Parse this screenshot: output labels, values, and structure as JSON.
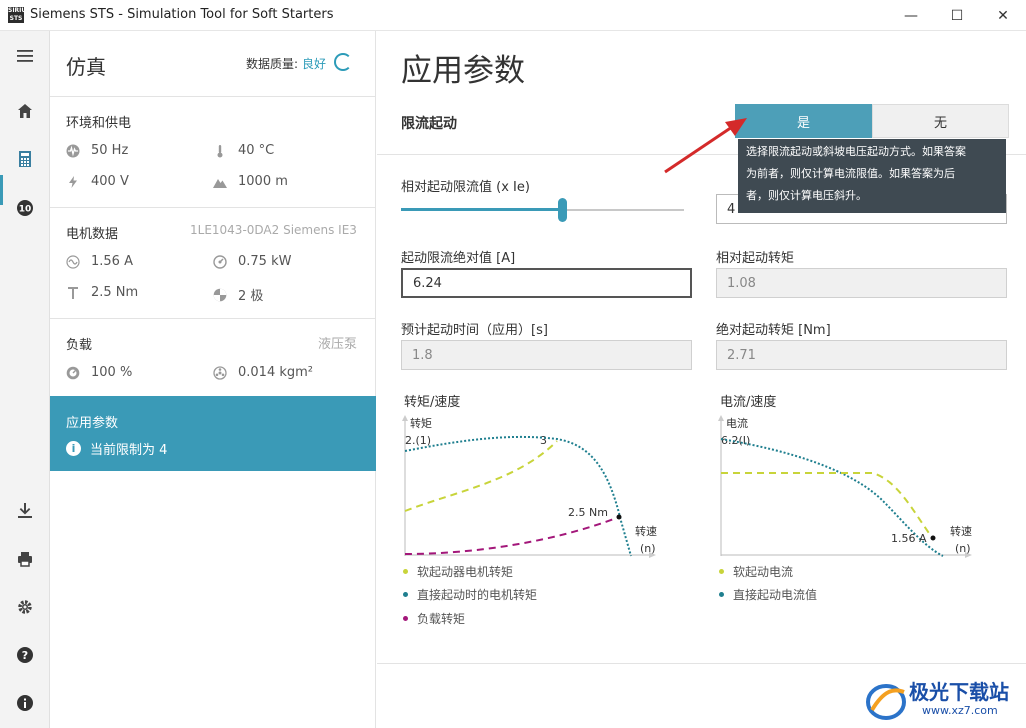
{
  "window": {
    "logo_text": "SIRIUS STS",
    "title": "Siemens STS - Simulation Tool for Soft Starters",
    "minimize": "—",
    "maximize": "☐",
    "close": "✕"
  },
  "rail": {
    "icons": [
      "menu-icon",
      "home-icon",
      "calculator-icon",
      "ten-icon",
      "download-icon",
      "print-icon",
      "settings-icon",
      "help-icon",
      "info-icon"
    ],
    "ten_label": "10"
  },
  "panel": {
    "title": "仿真",
    "quality_label": "数据质量:",
    "quality_value": "良好",
    "env": {
      "title": "环境和供电",
      "frequency": "50 Hz",
      "temperature": "40 °C",
      "voltage": "400 V",
      "altitude": "1000 m"
    },
    "motor": {
      "title": "电机数据",
      "model": "1LE1043-0DA2 Siemens IE3",
      "current": "1.56 A",
      "power": "0.75 kW",
      "torque": "2.5 Nm",
      "poles": "2 极"
    },
    "load": {
      "title": "负载",
      "type": "液压泵",
      "load_percent": "100 %",
      "inertia": "0.014 kgm²"
    },
    "active": {
      "title": "应用参数",
      "info_icon": "i",
      "info_text": "当前限制为 4"
    }
  },
  "main": {
    "title": "应用参数",
    "limit_label": "限流起动",
    "toggle_yes": "是",
    "toggle_no": "无",
    "tooltip_lines": [
      "选择限流起动或斜坡电压起动方式。如果答案",
      "为前者，则仅计算电流限值。如果答案为后",
      "者，则仅计算电压斜升。"
    ],
    "relative_limit_label": "相对起动限流值 (x Ie)",
    "relative_limit_value": "4",
    "slider_level": 0.57,
    "absolute_limit_label": "起动限流绝对值 [A]",
    "absolute_limit_value": "6.24",
    "relative_torque_label": "相对起动转矩",
    "relative_torque_value": "1.08",
    "est_time_label": "预计起动时间（应用）[s]",
    "est_time_value": "1.8",
    "absolute_torque_label": "绝对起动转矩 [Nm]",
    "absolute_torque_value": "2.71"
  },
  "chart_data": [
    {
      "type": "line",
      "title": "转矩/速度",
      "ylabel": "转矩",
      "xlabel": "转速 (n)",
      "annotations": [
        "2.(1)",
        "3",
        "2.5 Nm"
      ],
      "series": [
        {
          "name": "软起动器电机转矩",
          "color": "#c8d43a"
        },
        {
          "name": "直接起动时的电机转矩",
          "color": "#1f7f8f"
        },
        {
          "name": "负载转矩",
          "color": "#a3177a"
        }
      ]
    },
    {
      "type": "line",
      "title": "电流/速度",
      "ylabel": "电流",
      "xlabel": "转速 (n)",
      "annotations": [
        "6.2(I)",
        "1.56 A"
      ],
      "series": [
        {
          "name": "软起动电流",
          "color": "#c8d43a"
        },
        {
          "name": "直接起动电流值",
          "color": "#1f7f8f"
        }
      ]
    }
  ],
  "watermark": {
    "brand": "极光下载站",
    "url": "www.xz7.com"
  }
}
